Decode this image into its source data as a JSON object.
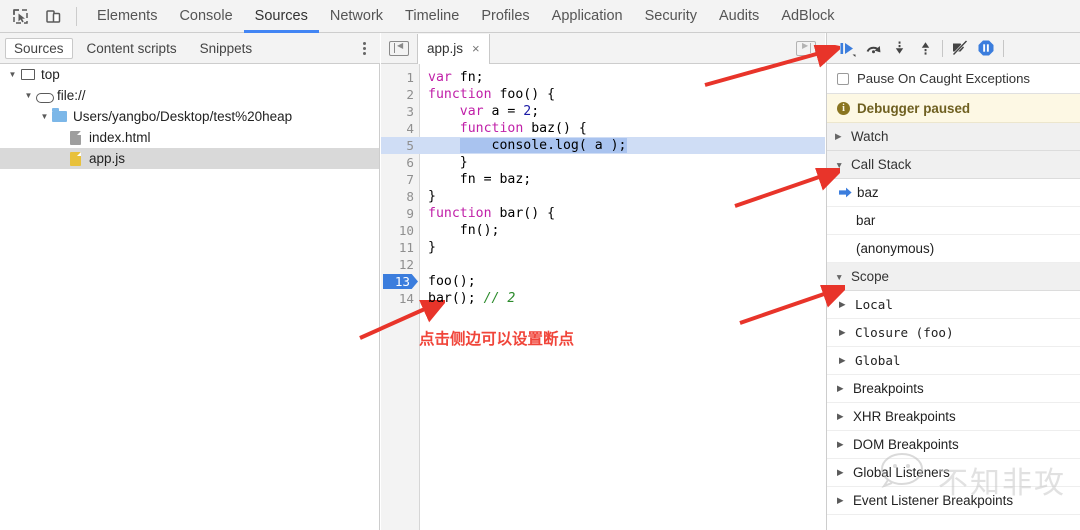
{
  "window": {
    "title": "Chrome DevTools - Sources - app.js"
  },
  "toolbar": {
    "inspect_icon": "inspect-element-icon",
    "device_icon": "device-toolbar-icon",
    "panels": [
      {
        "label": "Elements",
        "active": false
      },
      {
        "label": "Console",
        "active": false
      },
      {
        "label": "Sources",
        "active": true
      },
      {
        "label": "Network",
        "active": false
      },
      {
        "label": "Timeline",
        "active": false
      },
      {
        "label": "Profiles",
        "active": false
      },
      {
        "label": "Application",
        "active": false
      },
      {
        "label": "Security",
        "active": false
      },
      {
        "label": "Audits",
        "active": false
      },
      {
        "label": "AdBlock",
        "active": false
      }
    ]
  },
  "navigator": {
    "tabs": [
      {
        "label": "Sources",
        "active": true
      },
      {
        "label": "Content scripts",
        "active": false
      },
      {
        "label": "Snippets",
        "active": false
      }
    ],
    "more_label": "more-options",
    "tree": [
      {
        "label": "top",
        "indent": 0,
        "icon": "frame-icon",
        "expanded": true,
        "selected": false
      },
      {
        "label": "file://",
        "indent": 1,
        "icon": "cloud-icon",
        "expanded": true,
        "selected": false
      },
      {
        "label": "Users/yangbo/Desktop/test%20heap",
        "indent": 2,
        "icon": "folder-icon",
        "expanded": true,
        "selected": false
      },
      {
        "label": "index.html",
        "indent": 3,
        "icon": "file-gray-icon",
        "expanded": false,
        "selected": false
      },
      {
        "label": "app.js",
        "indent": 3,
        "icon": "file-yellow-icon",
        "expanded": false,
        "selected": true
      }
    ]
  },
  "editor": {
    "collapse_left_label": "show-navigator",
    "collapse_right_label": "show-debugger",
    "file_tab": {
      "label": "app.js",
      "close_label": "×"
    },
    "breakpoint_line": 13,
    "execution_line": 5,
    "lines": [
      {
        "n": 1,
        "text": "var fn;"
      },
      {
        "n": 2,
        "text": "function foo() {"
      },
      {
        "n": 3,
        "text": "    var a = 2;"
      },
      {
        "n": 4,
        "text": "    function baz() {"
      },
      {
        "n": 5,
        "text": "        console.log( a );"
      },
      {
        "n": 6,
        "text": "    }"
      },
      {
        "n": 7,
        "text": "    fn = baz;"
      },
      {
        "n": 8,
        "text": "}"
      },
      {
        "n": 9,
        "text": "function bar() {"
      },
      {
        "n": 10,
        "text": "    fn();"
      },
      {
        "n": 11,
        "text": "}"
      },
      {
        "n": 12,
        "text": ""
      },
      {
        "n": 13,
        "text": "foo();"
      },
      {
        "n": 14,
        "text": "bar(); // 2"
      }
    ],
    "annotation": "点击侧边可以设置断点"
  },
  "debugger": {
    "buttons": [
      {
        "name": "resume-script-execution-button",
        "label": "Resume script execution"
      },
      {
        "name": "step-over-button",
        "label": "Step over next function call"
      },
      {
        "name": "step-into-button",
        "label": "Step into next function call"
      },
      {
        "name": "step-out-button",
        "label": "Step out of current function"
      },
      {
        "name": "deactivate-breakpoints-button",
        "label": "Deactivate breakpoints"
      },
      {
        "name": "pause-on-exceptions-button",
        "label": "Pause on exceptions"
      }
    ],
    "pause_on_caught": {
      "label": "Pause On Caught Exceptions",
      "checked": false
    },
    "status": {
      "label": "Debugger paused",
      "icon": "info-icon"
    },
    "sections": [
      {
        "name": "watch",
        "label": "Watch",
        "expanded": false,
        "items": []
      },
      {
        "name": "call-stack",
        "label": "Call Stack",
        "expanded": true,
        "items": [
          {
            "label": "baz",
            "current": true
          },
          {
            "label": "bar",
            "current": false
          },
          {
            "label": "(anonymous)",
            "current": false
          }
        ]
      },
      {
        "name": "scope",
        "label": "Scope",
        "expanded": true,
        "items": [
          {
            "label": "Local",
            "mono": true
          },
          {
            "label": "Closure (foo)",
            "mono": true
          },
          {
            "label": "Global",
            "mono": true
          }
        ]
      },
      {
        "name": "breakpoints",
        "label": "Breakpoints",
        "expanded": false,
        "items": []
      },
      {
        "name": "xhr-breakpoints",
        "label": "XHR Breakpoints",
        "expanded": false,
        "items": []
      },
      {
        "name": "dom-breakpoints",
        "label": "DOM Breakpoints",
        "expanded": false,
        "items": []
      },
      {
        "name": "global-listeners",
        "label": "Global Listeners",
        "expanded": false,
        "items": []
      },
      {
        "name": "event-listener-breakpoints",
        "label": "Event Listener Breakpoints",
        "expanded": false,
        "items": []
      }
    ]
  },
  "watermark": {
    "text": "不知非攻",
    "icon": "wechat-icon"
  },
  "colors": {
    "accent_blue": "#4285f4",
    "breakpoint_blue": "#3b7ddd",
    "exec_line_bg": "#cfddf5",
    "paused_bg": "#fdf8e4",
    "annotation_red": "#f0453a",
    "keyword_purple": "#c020a8",
    "number_blue": "#1a1aa6",
    "comment_green": "#2c8b2c"
  }
}
